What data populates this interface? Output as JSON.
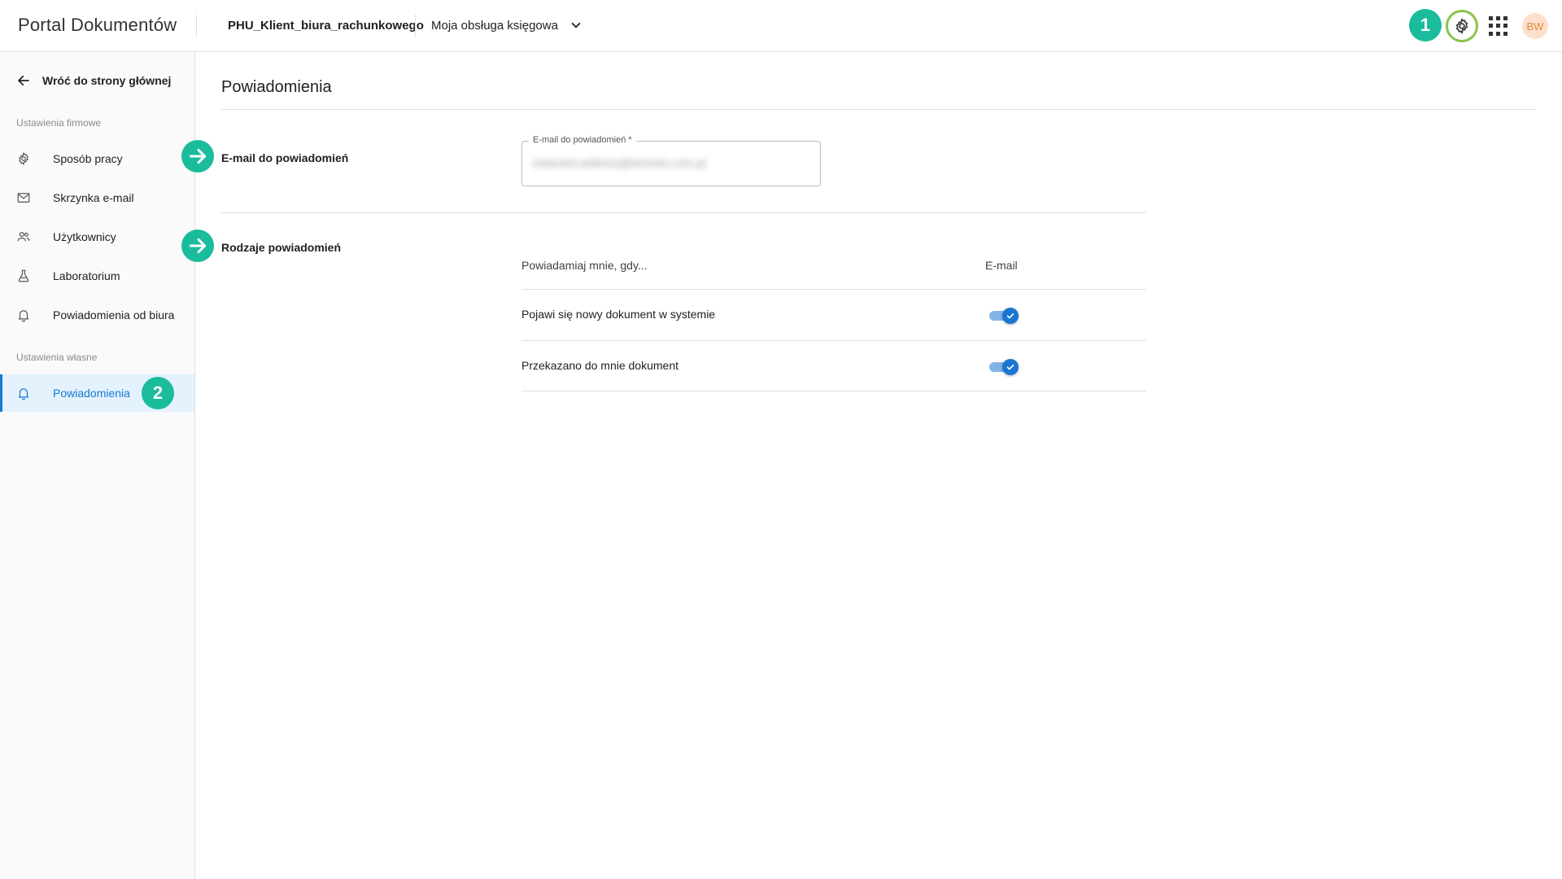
{
  "header": {
    "brand": "Portal Dokumentów",
    "client": "PHU_Klient_biura_rachunkowego",
    "service": "Moja obsługa księgowa",
    "badge_1": "1",
    "avatar": "BW"
  },
  "sidebar": {
    "back_label": "Wróć do strony głównej",
    "section_company": "Ustawienia firmowe",
    "section_own": "Ustawienia własne",
    "items": [
      {
        "label": "Sposób pracy",
        "icon": "gear-icon"
      },
      {
        "label": "Skrzynka e-mail",
        "icon": "mail-icon"
      },
      {
        "label": "Użytkownicy",
        "icon": "users-icon"
      },
      {
        "label": "Laboratorium",
        "icon": "flask-icon"
      },
      {
        "label": "Powiadomienia od biura",
        "icon": "bell-icon"
      }
    ],
    "active_item": {
      "label": "Powiadomienia",
      "icon": "bell-icon",
      "badge": "2"
    }
  },
  "main": {
    "title": "Powiadomienia",
    "email_row_label": "E-mail do powiadomień",
    "email_field": {
      "label": "E-mail do powiadomień *",
      "value": "redacted.address@domain.com.pl"
    },
    "types_row_label": "Rodzaje powiadomień",
    "table": {
      "col_event": "Powiadamiaj mnie, gdy...",
      "col_email": "E-mail",
      "rows": [
        {
          "label": "Pojawi się nowy dokument w systemie",
          "email_enabled": true
        },
        {
          "label": "Przekazano do mnie dokument",
          "email_enabled": true
        }
      ]
    }
  },
  "colors": {
    "accent": "#1976d2",
    "badge": "#1abc9c",
    "highlight_ring": "#8bc34a"
  }
}
